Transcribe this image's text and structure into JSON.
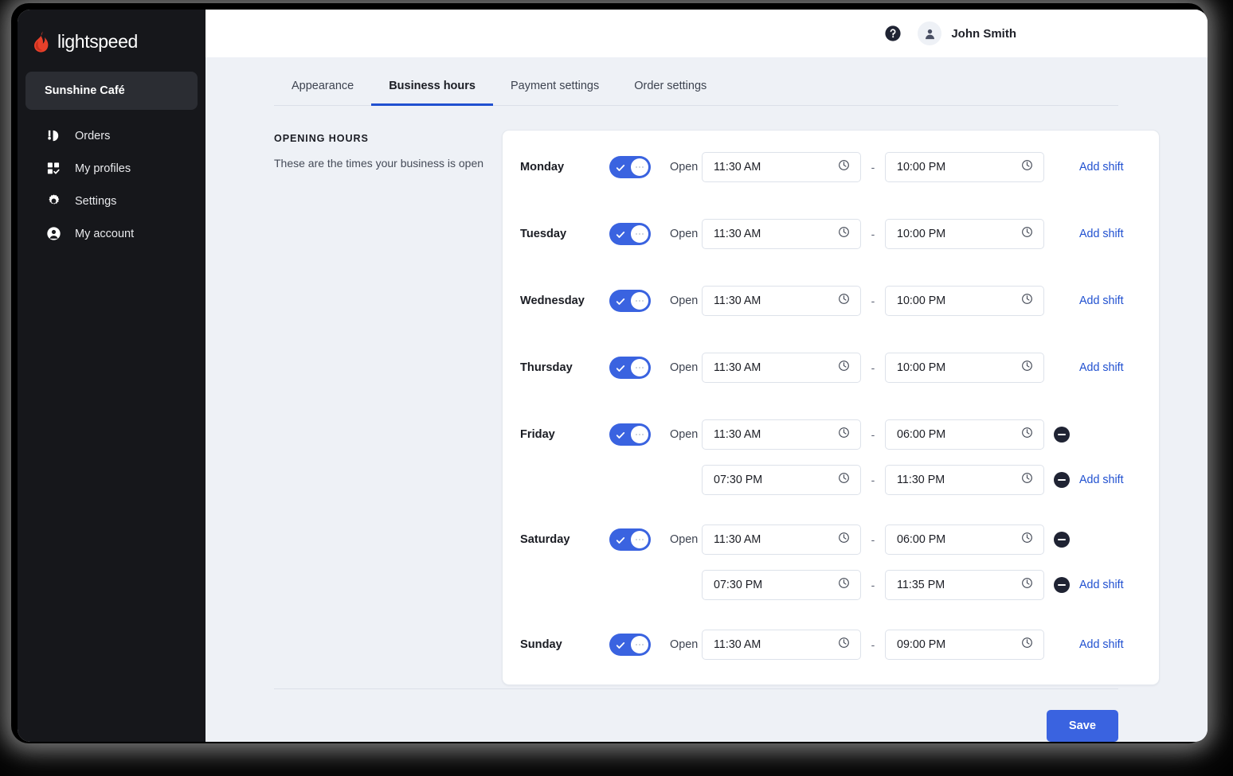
{
  "sidebar": {
    "brand": "lightspeed",
    "store": "Sunshine Café",
    "items": [
      {
        "label": "Orders",
        "icon": "orders-icon"
      },
      {
        "label": "My profiles",
        "icon": "profiles-icon"
      },
      {
        "label": "Settings",
        "icon": "gear-icon"
      },
      {
        "label": "My account",
        "icon": "account-icon"
      }
    ]
  },
  "topbar": {
    "help_icon": "help-circle-icon",
    "avatar_icon": "person-icon",
    "user_name": "John Smith"
  },
  "tabs": [
    {
      "label": "Appearance",
      "active": false
    },
    {
      "label": "Business hours",
      "active": true
    },
    {
      "label": "Payment settings",
      "active": false
    },
    {
      "label": "Order settings",
      "active": false
    }
  ],
  "section": {
    "title": "OPENING HOURS",
    "subtitle": "These are the times your business is open"
  },
  "labels": {
    "open": "Open",
    "dash": "-",
    "add_shift": "Add shift",
    "clock_icon": "clock-icon",
    "remove_icon": "remove-circle-icon"
  },
  "colors": {
    "accent_blue": "#3a63e0",
    "link_blue": "#2050d0",
    "tab_underline": "#2050d0",
    "sidebar_bg": "#16171b",
    "page_bg": "#eef1f6",
    "remove_dark": "#1f2333",
    "brand_red": "#e8402a"
  },
  "days": [
    {
      "name": "Monday",
      "open": true,
      "open_label": "Open",
      "shifts": [
        {
          "start": "11:30 AM",
          "end": "10:00 PM",
          "removable": false
        }
      ]
    },
    {
      "name": "Tuesday",
      "open": true,
      "open_label": "Open",
      "shifts": [
        {
          "start": "11:30 AM",
          "end": "10:00 PM",
          "removable": false
        }
      ]
    },
    {
      "name": "Wednesday",
      "open": true,
      "open_label": "Open",
      "shifts": [
        {
          "start": "11:30 AM",
          "end": "10:00 PM",
          "removable": false
        }
      ]
    },
    {
      "name": "Thursday",
      "open": true,
      "open_label": "Open",
      "shifts": [
        {
          "start": "11:30 AM",
          "end": "10:00 PM",
          "removable": false
        }
      ]
    },
    {
      "name": "Friday",
      "open": true,
      "open_label": "Open",
      "shifts": [
        {
          "start": "11:30 AM",
          "end": "06:00 PM",
          "removable": true
        },
        {
          "start": "07:30 PM",
          "end": "11:30 PM",
          "removable": true
        }
      ]
    },
    {
      "name": "Saturday",
      "open": true,
      "open_label": "Open",
      "shifts": [
        {
          "start": "11:30 AM",
          "end": "06:00 PM",
          "removable": true
        },
        {
          "start": "07:30 PM",
          "end": "11:35 PM",
          "removable": true
        }
      ]
    },
    {
      "name": "Sunday",
      "open": true,
      "open_label": "Open",
      "shifts": [
        {
          "start": "11:30 AM",
          "end": "09:00 PM",
          "removable": false
        }
      ]
    }
  ],
  "footer": {
    "save_label": "Save"
  }
}
